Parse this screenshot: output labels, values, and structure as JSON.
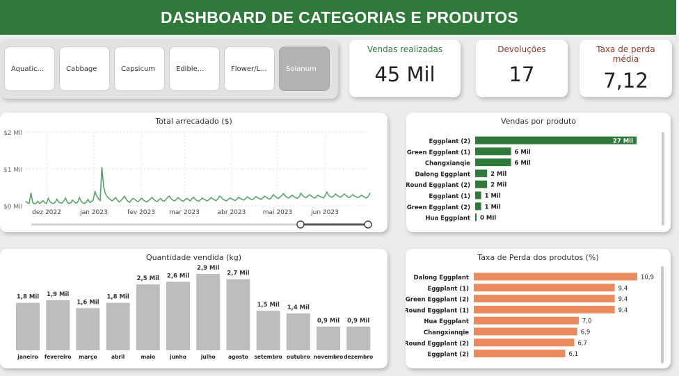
{
  "header": {
    "title": "DASHBOARD DE CATEGORIAS E PRODUTOS"
  },
  "slicer": {
    "items": [
      {
        "label": "Aquatic...",
        "selected": false
      },
      {
        "label": "Cabbage",
        "selected": false
      },
      {
        "label": "Capsicum",
        "selected": false
      },
      {
        "label": "Edible...",
        "selected": false
      },
      {
        "label": "Flower/L...",
        "selected": false
      },
      {
        "label": "Solanum",
        "selected": true
      }
    ]
  },
  "kpis": {
    "vendas": {
      "label": "Vendas realizadas",
      "value": "45 Mil",
      "color": "#2f7a3a"
    },
    "devolucoes": {
      "label": "Devoluções",
      "value": "17",
      "color": "#8a3b2a"
    },
    "perda": {
      "label": "Taxa de perda média",
      "value": "7,12",
      "color": "#8a3b2a"
    }
  },
  "charts": {
    "total": {
      "title": "Total arrecadado ($)",
      "chart_data": {
        "type": "line",
        "title": "Total arrecadado ($)",
        "y_ticks": [
          "$2 Mil",
          "$1 Mil",
          "$0 Mil"
        ],
        "ylim": [
          0,
          2000
        ],
        "x_ticks": [
          "dez 2022",
          "jan 2023",
          "fev 2023",
          "mar 2023",
          "abr 2023",
          "mai 2023",
          "jun 2023"
        ],
        "color": "#5aa36d",
        "values": [
          120,
          80,
          60,
          350,
          90,
          50,
          70,
          120,
          60,
          90,
          140,
          80,
          60,
          200,
          110,
          70,
          60,
          90,
          180,
          100,
          80,
          70,
          130,
          210,
          90,
          60,
          80,
          150,
          110,
          70,
          90,
          220,
          130,
          80,
          60,
          100,
          170,
          90,
          110,
          160,
          380,
          270,
          190,
          140,
          1050,
          520,
          330,
          250,
          200,
          160,
          130,
          180,
          220,
          150,
          100,
          140,
          190,
          260,
          180,
          120,
          90,
          150,
          200,
          170,
          130,
          110,
          160,
          210,
          150,
          120,
          100,
          140,
          180,
          230,
          170,
          130,
          110,
          160,
          200,
          140,
          120,
          170,
          230,
          260,
          190,
          150,
          130,
          170,
          220,
          180,
          140,
          120,
          160,
          200,
          170,
          130,
          190,
          230,
          170,
          140,
          120,
          160,
          210,
          180,
          150,
          130,
          170,
          220,
          190,
          160,
          140,
          180,
          260,
          230,
          170,
          150,
          130,
          170,
          210,
          190,
          160,
          140,
          180,
          230,
          200,
          170,
          150,
          190,
          240,
          210,
          180,
          160,
          200,
          250,
          220,
          190,
          170,
          210,
          260,
          230,
          200,
          180,
          220,
          300,
          260,
          220,
          200,
          240,
          280,
          330,
          260,
          230,
          210,
          250,
          290,
          240,
          220,
          200,
          240,
          340,
          280,
          240,
          220,
          260,
          300,
          260,
          230,
          210,
          250,
          290,
          250,
          230,
          210,
          270,
          370,
          290,
          250,
          230,
          270,
          320,
          280,
          250,
          230,
          270,
          320,
          280,
          240,
          220,
          260,
          300,
          260,
          240,
          220,
          250,
          290,
          250,
          230,
          210,
          250,
          350
        ]
      }
    },
    "vendas_produto": {
      "title": "Vendas por produto",
      "chart_data": {
        "type": "bar",
        "orientation": "horizontal",
        "title": "Vendas por produto",
        "color": "#2f7a3a",
        "categories": [
          "Eggplant (2)",
          "Green Eggplant (1)",
          "Changxianqie",
          "Dalong Eggplant",
          "Round Eggplant (2)",
          "Eggplant (1)",
          "Green Eggplant (2)",
          "Hua Eggplant"
        ],
        "values": [
          27000,
          6000,
          6000,
          2000,
          2000,
          1000,
          1000,
          0
        ],
        "labels": [
          "27 Mil",
          "6 Mil",
          "6 Mil",
          "2 Mil",
          "2 Mil",
          "1 Mil",
          "1 Mil",
          "0 Mil"
        ]
      }
    },
    "quantidade": {
      "title": "Quantidade vendida (kg)",
      "chart_data": {
        "type": "bar",
        "title": "Quantidade vendida (kg)",
        "color": "#bdbdbd",
        "categories": [
          "janeiro",
          "fevereiro",
          "março",
          "abril",
          "maio",
          "junho",
          "julho",
          "agosto",
          "setembro",
          "outubro",
          "novembro",
          "dezembro"
        ],
        "values": [
          1800,
          1900,
          1600,
          1800,
          2500,
          2600,
          2900,
          2700,
          1500,
          1400,
          900,
          900
        ],
        "labels": [
          "1,8 Mil",
          "1,9 Mil",
          "1,6 Mil",
          "1,8 Mil",
          "2,5 Mil",
          "2,6 Mil",
          "2,9 Mil",
          "2,7 Mil",
          "1,5 Mil",
          "1,4 Mil",
          "0,9 Mil",
          "0,9 Mil"
        ]
      }
    },
    "perda_produto": {
      "title": "Taxa de Perda dos produtos (%)",
      "chart_data": {
        "type": "bar",
        "orientation": "horizontal",
        "title": "Taxa de Perda dos produtos (%)",
        "color": "#e98b5f",
        "categories": [
          "Dalong Eggplant",
          "Eggplant (1)",
          "Green Eggplant (2)",
          "Round Eggplant (1)",
          "Hua Eggplant",
          "Changxianqie",
          "Round Eggplant (2)",
          "Eggplant (2)"
        ],
        "values": [
          10.9,
          9.4,
          9.4,
          9.4,
          7.0,
          6.9,
          6.7,
          6.1
        ],
        "labels": [
          "10,9",
          "9,4",
          "9,4",
          "9,4",
          "7,0",
          "6,9",
          "6,7",
          "6,1"
        ]
      }
    }
  }
}
